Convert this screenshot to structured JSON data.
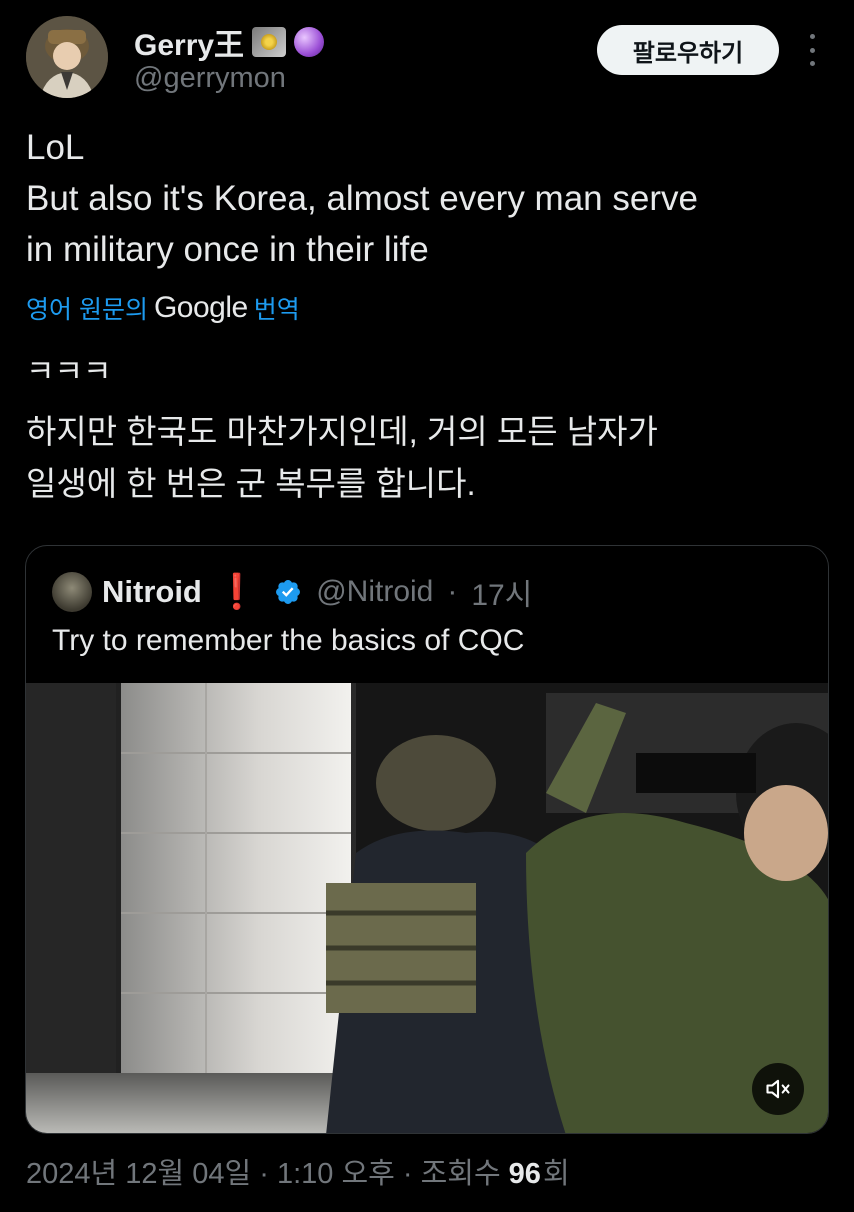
{
  "author": {
    "display_name": "Gerry王",
    "handle": "@gerrymon",
    "badges": [
      "disc-icon",
      "crystal-ball-icon"
    ]
  },
  "follow_button": {
    "label": "팔로우하기"
  },
  "more_icon": "more-vertical-icon",
  "tweet": {
    "text": "LoL\nBut also it's Korea, almost every man serve\nin military once in their life"
  },
  "translate": {
    "prefix": "영어 원문의",
    "brand": "Google",
    "suffix": "번역"
  },
  "translation": {
    "line1": "ㅋㅋㅋ",
    "body": "하지만 한국도 마찬가지인데, 거의 모든 남자가\n일생에 한 번은 군 복무를 합니다."
  },
  "quote": {
    "display_name": "Nitroid",
    "emoji": "❗",
    "verified": true,
    "handle": "@Nitroid",
    "time": "17시",
    "text": "Try to remember the basics of CQC",
    "media": {
      "type": "video",
      "muted": true,
      "mute_icon": "volume-muted-icon"
    }
  },
  "meta": {
    "date": "2024년 12월 04일",
    "time": "1:10 오후",
    "views_label": "조회수",
    "views_count": "96",
    "views_suffix": "회",
    "sep": " · "
  },
  "colors": {
    "background": "#000000",
    "text": "#e7e9ea",
    "secondary": "#71767b",
    "link": "#1d9bf0",
    "verified": "#1d9bf0",
    "border": "#2f3336"
  }
}
